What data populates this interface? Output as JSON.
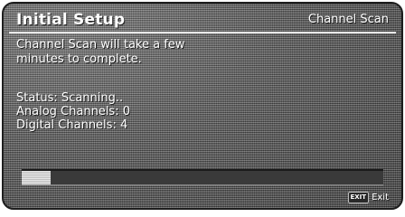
{
  "header": {
    "title": "Initial Setup",
    "section": "Channel Scan"
  },
  "message": {
    "line1": "Channel Scan will take a few",
    "line2": "minutes to complete."
  },
  "status": {
    "status_line": "Status: Scanning..",
    "analog_line": "Analog Channels: 0",
    "digital_line": "Digital Channels: 4"
  },
  "progress": {
    "fraction": 0.08
  },
  "footer": {
    "exit_key": "EXIT",
    "exit_label": "Exit"
  }
}
